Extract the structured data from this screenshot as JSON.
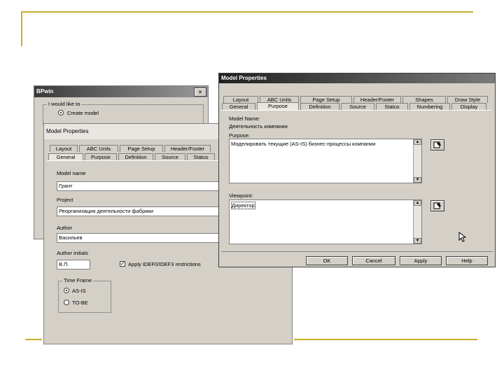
{
  "bpwin": {
    "title": "BPwin",
    "close_glyph": "✕",
    "intro": "I would like to",
    "option_create": "Create model"
  },
  "mp_left": {
    "title": "Model Properties",
    "tabs_row1": [
      "Layout",
      "ABC Units",
      "Page Setup",
      "Header/Footer"
    ],
    "tabs_row2": [
      "General",
      "Purpose",
      "Definition",
      "Source",
      "Status"
    ],
    "model_name_label": "Model name",
    "model_name_value": "Грант",
    "project_label": "Project",
    "project_value": "Реорганизация деятельности фабрики",
    "author_label": "Author",
    "author_value": "Васильев",
    "author_initials_label": "Author initials",
    "author_initials_value": "В.П.",
    "idef_checkbox_label": "Apply IDEF0/IDEF3 restrictions",
    "time_frame_label": "Time Frame",
    "time_frame_options": [
      "AS-IS",
      "TO-BE"
    ]
  },
  "mp_right": {
    "title": "Model Properties",
    "tabs_row1": [
      "Layout",
      "ABC Units",
      "Page Setup",
      "Header/Footer",
      "Shapes",
      "Draw Style"
    ],
    "tabs_row2": [
      "General",
      "Purpose",
      "Definition",
      "Source",
      "Status",
      "Numbering",
      "Display"
    ],
    "model_name_label": "Model Name:",
    "model_name_value": "Деятельность компании",
    "purpose_label": "Purpose:",
    "purpose_value": "Моделировать текущие (AS-IS) бизнес-процессы компании",
    "viewpoint_label": "Viewpoint:",
    "viewpoint_value": "Директор",
    "buttons": [
      "OK",
      "Cancel",
      "Apply",
      "Help"
    ]
  }
}
